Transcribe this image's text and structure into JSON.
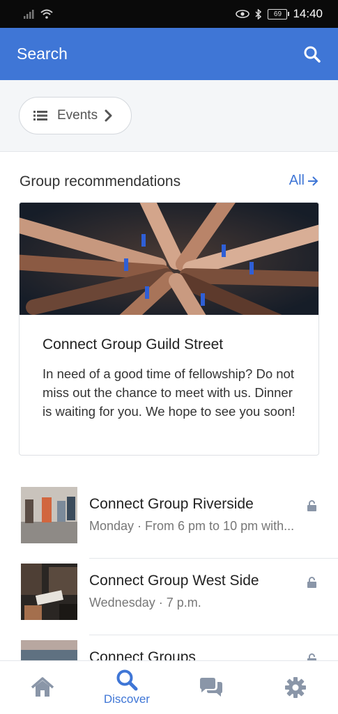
{
  "status_bar": {
    "time": "14:40",
    "battery": "69"
  },
  "header": {
    "title": "Search"
  },
  "filter": {
    "label": "Events"
  },
  "recommendations": {
    "title": "Group recommendations",
    "see_all": "All",
    "card": {
      "title": "Connect Group Guild Street",
      "description": "In need of a good time of fellowship? Do not miss out the chance to meet with us. Dinner is waiting for you. We hope to see you soon!"
    }
  },
  "groups": [
    {
      "title": "Connect Group Riverside",
      "subtitle": "Monday · From 6 pm to 10 pm with..."
    },
    {
      "title": "Connect Group West Side",
      "subtitle": "Wednesday · 7 p.m."
    },
    {
      "title": "Connect Groups",
      "subtitle": ""
    }
  ],
  "bottom_nav": [
    {
      "icon": "home-icon",
      "label": ""
    },
    {
      "icon": "search-icon",
      "label": "Discover",
      "active": true
    },
    {
      "icon": "chat-icon",
      "label": ""
    },
    {
      "icon": "settings-icon",
      "label": ""
    }
  ],
  "colors": {
    "accent": "#3f76d6",
    "icon_gray": "#8a96a8"
  }
}
